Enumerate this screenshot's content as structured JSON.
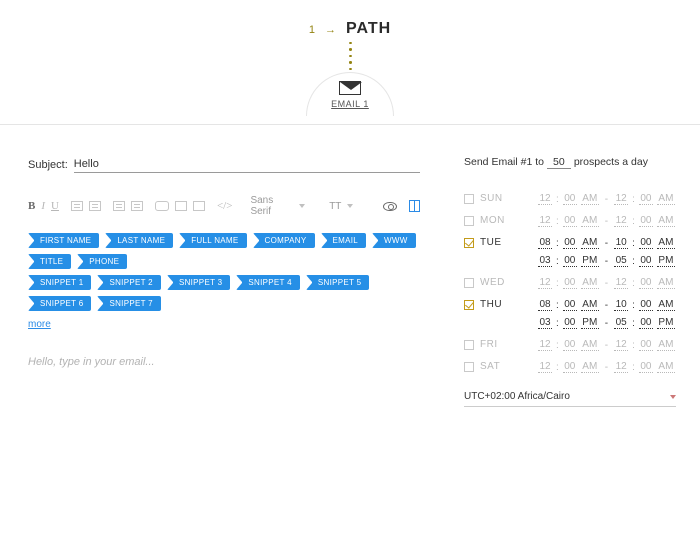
{
  "header": {
    "index": "1",
    "arrow": "→",
    "title": "PATH",
    "email_label": "EMAIL 1"
  },
  "subject": {
    "label": "Subject:",
    "value": "Hello"
  },
  "toolbar": {
    "bold": "B",
    "italic": "I",
    "underline": "U",
    "code": "</>",
    "font": "Sans Serif",
    "size": "TT"
  },
  "pills": {
    "row1": [
      "FIRST NAME",
      "LAST NAME",
      "FULL NAME",
      "COMPANY",
      "EMAIL",
      "WWW",
      "TITLE",
      "PHONE"
    ],
    "row2": [
      "SNIPPET 1",
      "SNIPPET 2",
      "SNIPPET 3",
      "SNIPPET 4",
      "SNIPPET 5",
      "SNIPPET 6",
      "SNIPPET 7"
    ],
    "more": "more"
  },
  "body": {
    "placeholder": "Hello, type in your email..."
  },
  "send": {
    "prefix": "Send Email #1 to",
    "count": "50",
    "suffix": "prospects a day"
  },
  "schedule": {
    "days": [
      {
        "name": "SUN",
        "on": false,
        "slots": [
          {
            "h1": "12",
            "m1": "00",
            "p1": "AM",
            "h2": "12",
            "m2": "00",
            "p2": "AM"
          }
        ]
      },
      {
        "name": "MON",
        "on": false,
        "slots": [
          {
            "h1": "12",
            "m1": "00",
            "p1": "AM",
            "h2": "12",
            "m2": "00",
            "p2": "AM"
          }
        ]
      },
      {
        "name": "TUE",
        "on": true,
        "slots": [
          {
            "h1": "08",
            "m1": "00",
            "p1": "AM",
            "h2": "10",
            "m2": "00",
            "p2": "AM"
          },
          {
            "h1": "03",
            "m1": "00",
            "p1": "PM",
            "h2": "05",
            "m2": "00",
            "p2": "PM"
          }
        ]
      },
      {
        "name": "WED",
        "on": false,
        "slots": [
          {
            "h1": "12",
            "m1": "00",
            "p1": "AM",
            "h2": "12",
            "m2": "00",
            "p2": "AM"
          }
        ]
      },
      {
        "name": "THU",
        "on": true,
        "slots": [
          {
            "h1": "08",
            "m1": "00",
            "p1": "AM",
            "h2": "10",
            "m2": "00",
            "p2": "AM"
          },
          {
            "h1": "03",
            "m1": "00",
            "p1": "PM",
            "h2": "05",
            "m2": "00",
            "p2": "PM"
          }
        ]
      },
      {
        "name": "FRI",
        "on": false,
        "slots": [
          {
            "h1": "12",
            "m1": "00",
            "p1": "AM",
            "h2": "12",
            "m2": "00",
            "p2": "AM"
          }
        ]
      },
      {
        "name": "SAT",
        "on": false,
        "slots": [
          {
            "h1": "12",
            "m1": "00",
            "p1": "AM",
            "h2": "12",
            "m2": "00",
            "p2": "AM"
          }
        ]
      }
    ]
  },
  "timezone": {
    "value": "UTC+02:00 Africa/Cairo"
  }
}
